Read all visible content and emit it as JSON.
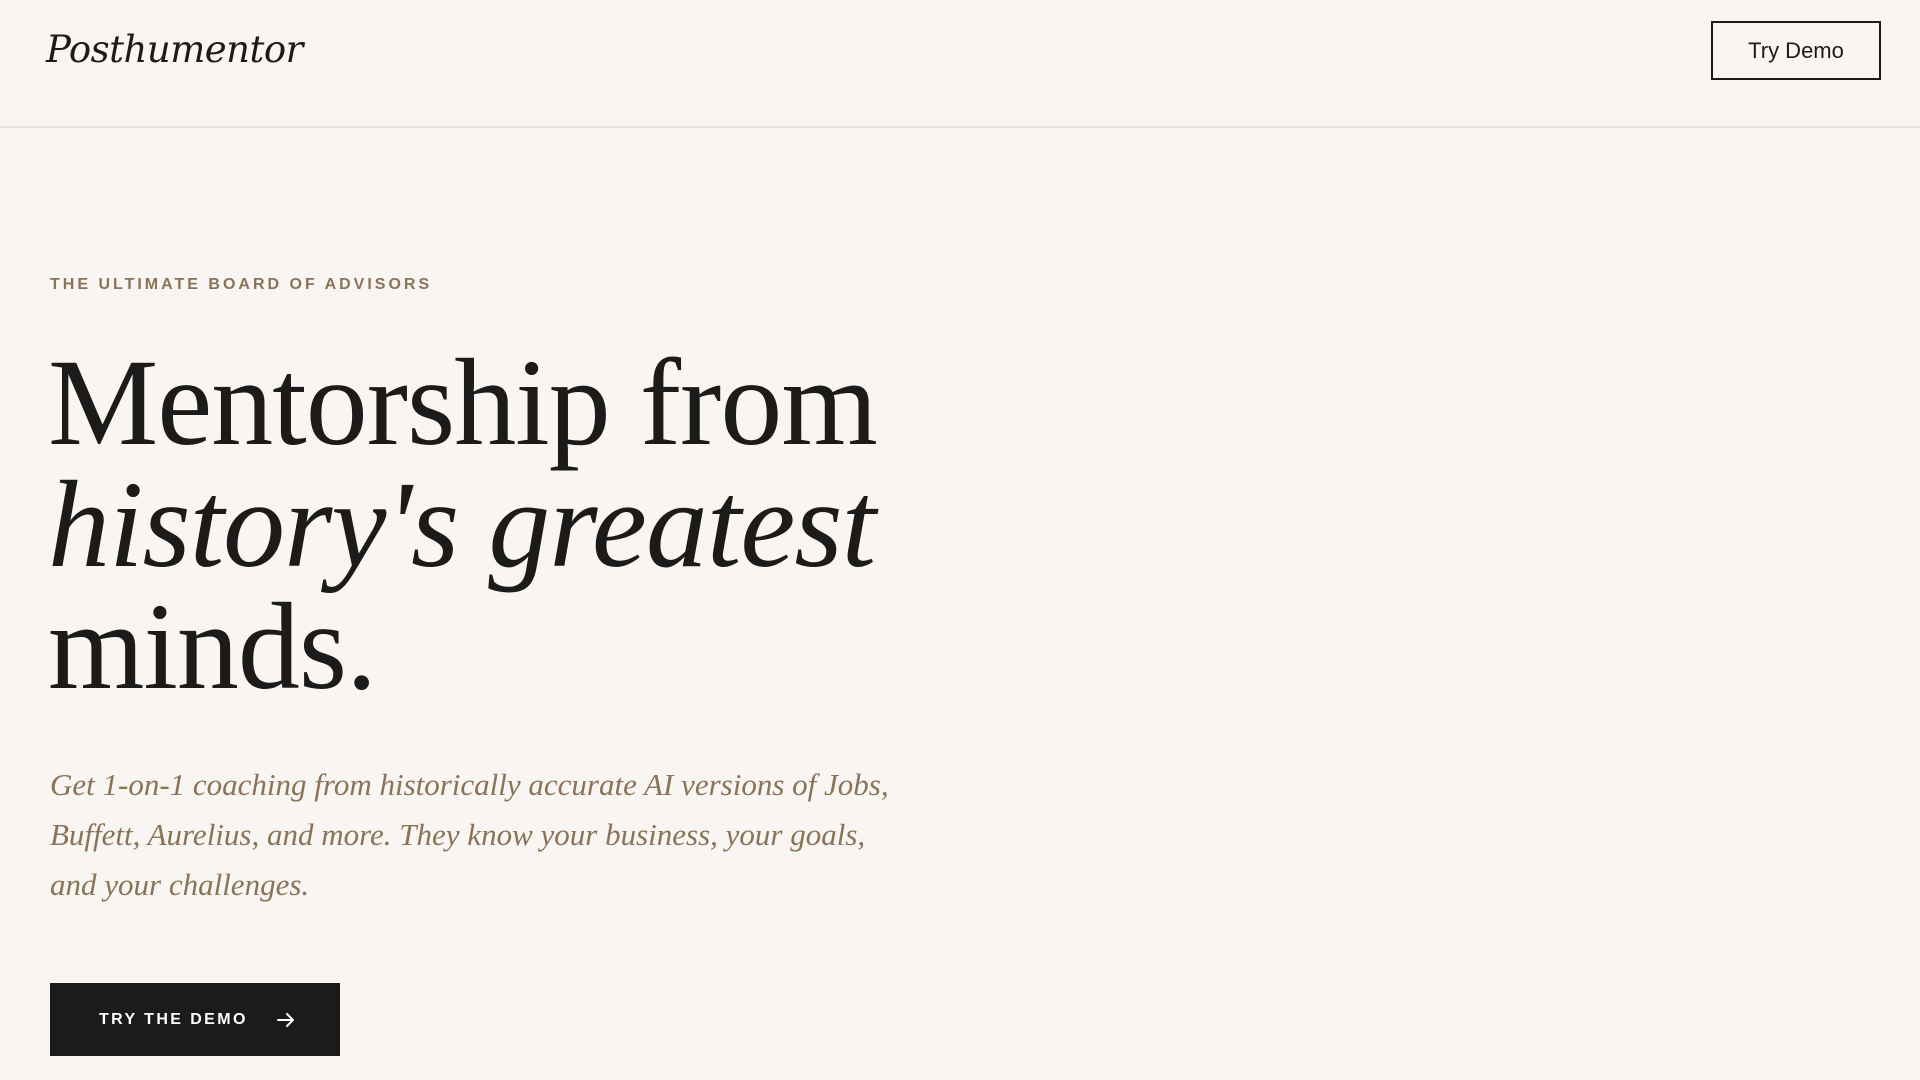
{
  "header": {
    "logo": "Posthumentor",
    "cta_label": "Try Demo"
  },
  "hero": {
    "eyebrow": "THE ULTIMATE BOARD OF ADVISORS",
    "headline": {
      "line1": "Mentorship from",
      "line2": "history's greatest",
      "line3": "minds."
    },
    "subtitle": "Get 1-on-1 coaching from historically accurate AI versions of Jobs, Buffett, Aurelius, and more. They know your business, your goals, and your challenges.",
    "cta_label": "TRY THE DEMO",
    "cta_icon": "arrow-right-icon"
  },
  "colors": {
    "background": "#f8f5f2",
    "text": "#1c1b19",
    "accent": "#8a7357",
    "divider": "#e6e2de"
  }
}
